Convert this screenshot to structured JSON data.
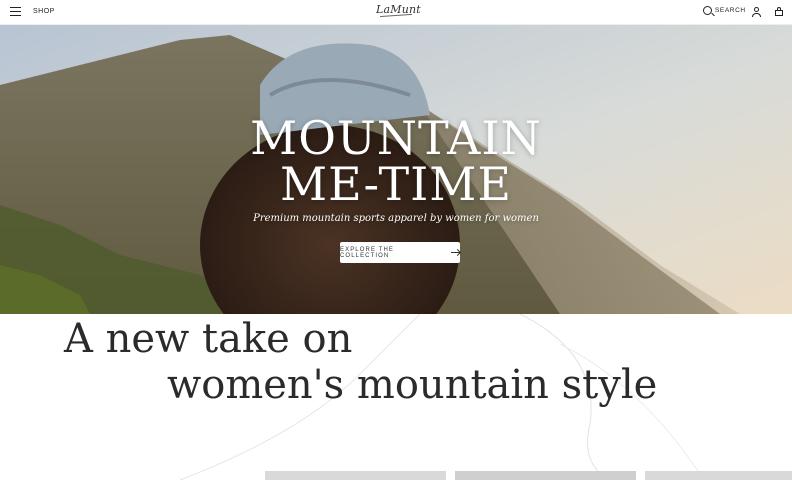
{
  "header": {
    "shop_label": "SHOP",
    "logo_text": "LaMunt",
    "search_label": "SEARCH",
    "icons": [
      "menu-icon",
      "search-icon",
      "account-icon",
      "cart-icon"
    ]
  },
  "hero": {
    "title_line1": "MOUNTAIN",
    "title_line2": "ME-TIME",
    "subtitle": "Premium mountain sports apparel by women for women",
    "cta_label": "EXPLORE THE COLLECTION"
  },
  "intro": {
    "line1": "A new take on",
    "line2": "women's mountain style"
  },
  "colors": {
    "sky": "#b9c3cf",
    "mountain": "#6e6a52",
    "headline": "#2b2b2b",
    "header_bg": "#ffffff"
  }
}
